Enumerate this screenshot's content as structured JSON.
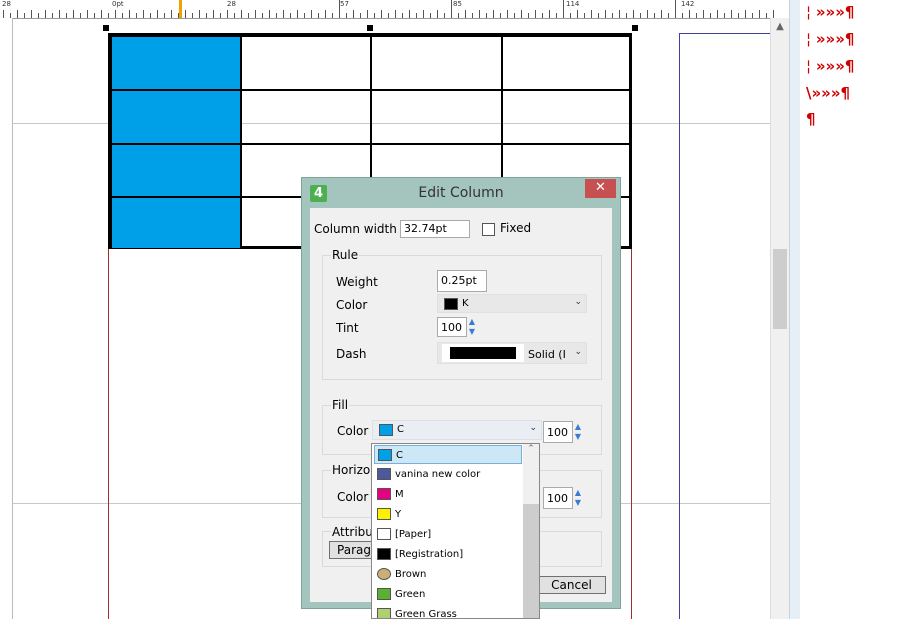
{
  "ruler": {
    "labels": [
      "28",
      "0pt",
      "28",
      "57",
      "85",
      "114",
      "142"
    ]
  },
  "story_editor": {
    "lines": [
      "»»»¶",
      "»»»¶",
      "»»»¶",
      "\\»»»¶",
      "¶"
    ]
  },
  "colors": {
    "cell_fill": "#00a0e9",
    "dialog_frame": "#a3c5bd",
    "close_button": "#c75050",
    "story_marks": "#d00000"
  },
  "dialog": {
    "app_icon": "4",
    "title": "Edit Column",
    "close_glyph": "✕",
    "column_width_label": "Column width",
    "column_width_value": "32.74pt",
    "fixed_label": "Fixed",
    "rule": {
      "group_label": "Rule",
      "weight_label": "Weight",
      "weight_value": "0.25pt",
      "color_label": "Color",
      "color_value": "K",
      "tint_label": "Tint",
      "tint_value": "100",
      "dash_label": "Dash",
      "dash_value": "Solid (I"
    },
    "fill": {
      "group_label": "Fill",
      "color_label": "Color",
      "color_value": "C",
      "tint_value": "100"
    },
    "horizontal": {
      "group_label": "Horizon",
      "color_label": "Color",
      "tint_value": "100"
    },
    "attributes": {
      "group_label": "Attribut",
      "paragraph_button": "Parag"
    },
    "cancel_button": "Cancel"
  },
  "dropdown": {
    "items": [
      {
        "name": "C",
        "color": "#00a0e9",
        "selected": true
      },
      {
        "name": "vanina new color",
        "color": "#4a5a9a"
      },
      {
        "name": "M",
        "color": "#e4007f"
      },
      {
        "name": "Y",
        "color": "#fff100"
      },
      {
        "name": "[Paper]",
        "color": "#ffffff"
      },
      {
        "name": "[Registration]",
        "color": "#000000"
      },
      {
        "name": "Brown",
        "color": "#c8b078",
        "round": true
      },
      {
        "name": "Green",
        "color": "#5ab030"
      },
      {
        "name": "Green Grass",
        "color": "#b0d070"
      }
    ]
  }
}
